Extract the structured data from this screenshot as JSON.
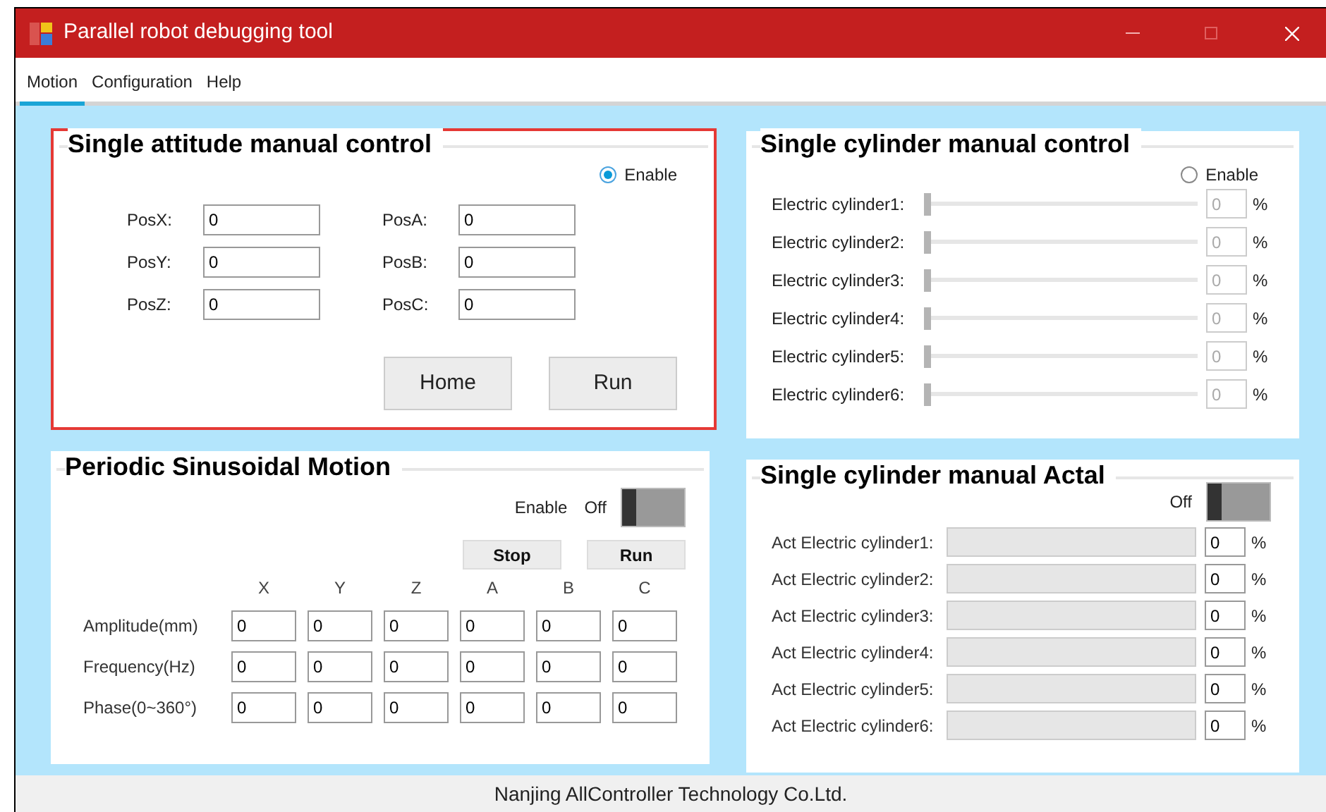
{
  "window": {
    "title": "Parallel robot debugging tool"
  },
  "menu": [
    {
      "label": "Motion",
      "selected": true
    },
    {
      "label": "Configuration",
      "selected": false
    },
    {
      "label": "Help",
      "selected": false
    }
  ],
  "attitude": {
    "title": "Single attitude manual control",
    "enable": {
      "label": "Enable",
      "selected": true
    },
    "fields_left": [
      {
        "label": "PosX:",
        "value": "0"
      },
      {
        "label": "PosY:",
        "value": "0"
      },
      {
        "label": "PosZ:",
        "value": "0"
      }
    ],
    "fields_right": [
      {
        "label": "PosA:",
        "value": "0"
      },
      {
        "label": "PosB:",
        "value": "0"
      },
      {
        "label": "PosC:",
        "value": "0"
      }
    ],
    "buttons": [
      "Home",
      "Run"
    ]
  },
  "cylinders": {
    "title": "Single cylinder manual control",
    "enable": {
      "label": "Enable",
      "selected": false
    },
    "disabled": true,
    "rows": [
      {
        "label": "Electric cylinder1:",
        "level": 0,
        "value": "0",
        "unit": "%"
      },
      {
        "label": "Electric cylinder2:",
        "level": 0,
        "value": "0",
        "unit": "%"
      },
      {
        "label": "Electric cylinder3:",
        "level": 0,
        "value": "0",
        "unit": "%"
      },
      {
        "label": "Electric cylinder4:",
        "level": 0,
        "value": "0",
        "unit": "%"
      },
      {
        "label": "Electric cylinder5:",
        "level": 0,
        "value": "0",
        "unit": "%"
      },
      {
        "label": "Electric cylinder6:",
        "level": 0,
        "value": "0",
        "unit": "%"
      }
    ]
  },
  "sinusoidal": {
    "title": "Periodic Sinusoidal Motion",
    "enable_label": "Enable",
    "toggle": {
      "label": "Off",
      "on": false
    },
    "buttons": [
      "Stop",
      "Run"
    ],
    "columns": [
      "X",
      "Y",
      "Z",
      "A",
      "B",
      "C"
    ],
    "rows": [
      {
        "label": "Amplitude(mm)",
        "values": [
          "0",
          "0",
          "0",
          "0",
          "0",
          "0"
        ]
      },
      {
        "label": "Frequency(Hz)",
        "values": [
          "0",
          "0",
          "0",
          "0",
          "0",
          "0"
        ]
      },
      {
        "label": "Phase(0~360°)",
        "values": [
          "0",
          "0",
          "0",
          "0",
          "0",
          "0"
        ]
      }
    ]
  },
  "actual": {
    "title": "Single cylinder manual Actal",
    "toggle": {
      "label": "Off",
      "on": false
    },
    "rows": [
      {
        "label": "Act Electric cylinder1:",
        "level": 0,
        "value": "0",
        "unit": "%"
      },
      {
        "label": "Act Electric cylinder2:",
        "level": 0,
        "value": "0",
        "unit": "%"
      },
      {
        "label": "Act Electric cylinder3:",
        "level": 0,
        "value": "0",
        "unit": "%"
      },
      {
        "label": "Act Electric cylinder4:",
        "level": 0,
        "value": "0",
        "unit": "%"
      },
      {
        "label": "Act Electric cylinder5:",
        "level": 0,
        "value": "0",
        "unit": "%"
      },
      {
        "label": "Act Electric cylinder6:",
        "level": 0,
        "value": "0",
        "unit": "%"
      }
    ]
  },
  "status_bar": "Nanjing AllController Technology Co.Ltd."
}
